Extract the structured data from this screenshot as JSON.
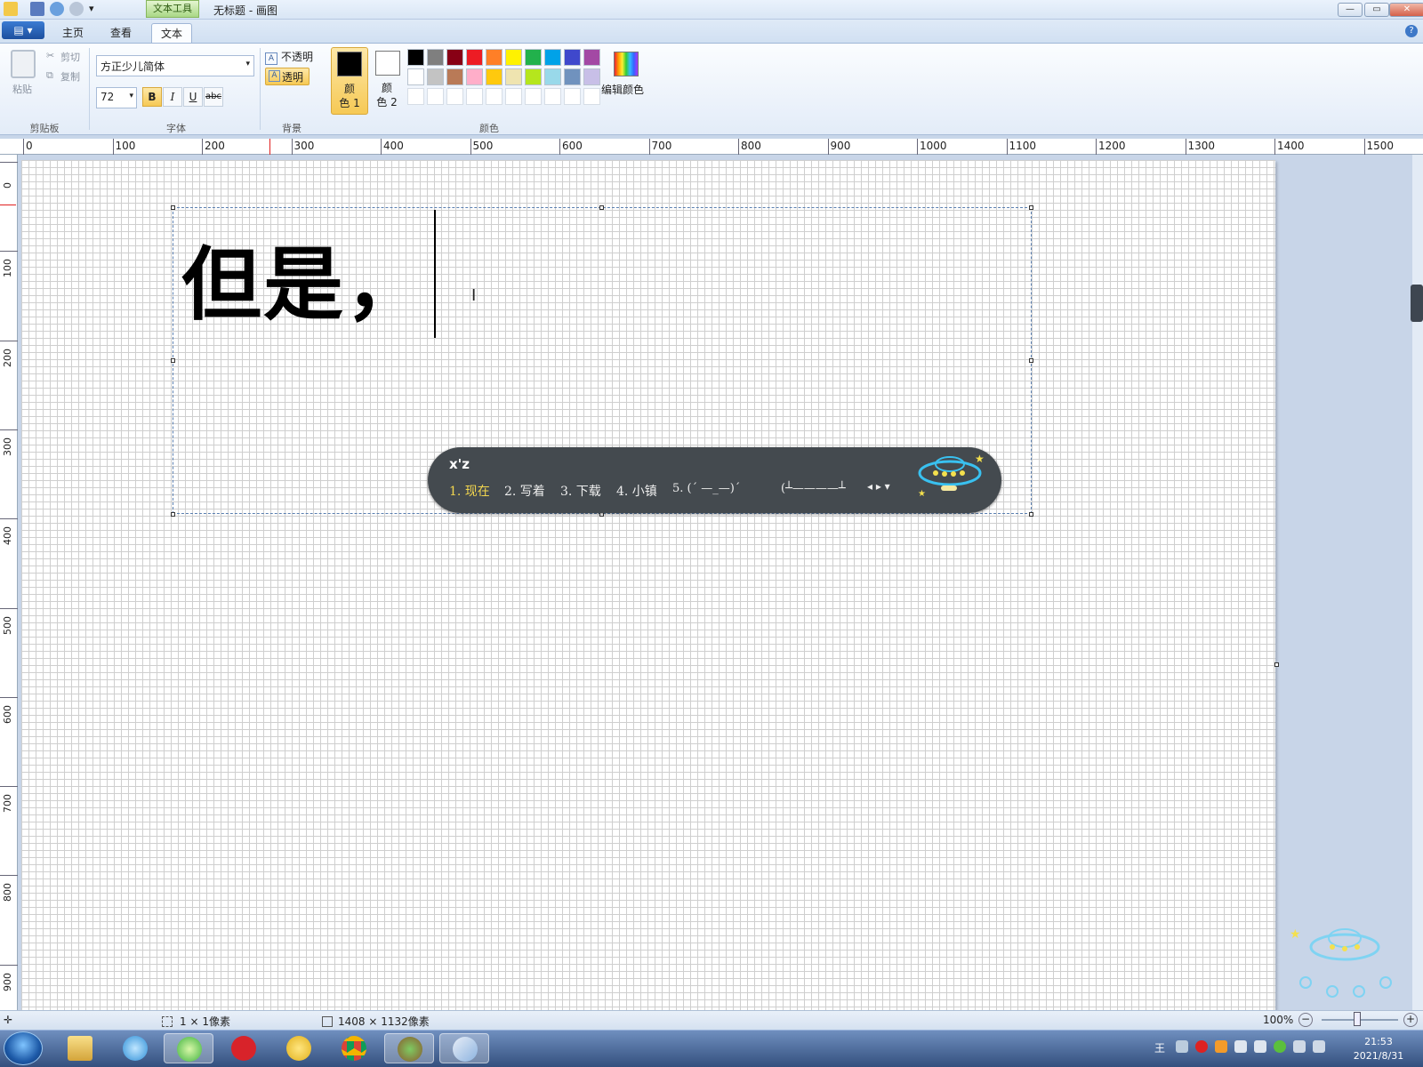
{
  "window": {
    "title": "无标题 - 画图",
    "context_tab": "文本工具",
    "buttons": {
      "minimize": "—",
      "maximize": "▭",
      "close": "✕"
    }
  },
  "tabs": {
    "file": "▤ ▾",
    "items": [
      {
        "label": "主页",
        "active": false
      },
      {
        "label": "查看",
        "active": false
      },
      {
        "label": "文本",
        "active": true
      }
    ],
    "help": "?"
  },
  "ribbon": {
    "clipboard": {
      "paste": "粘贴",
      "cut": "剪切",
      "copy": "复制",
      "group": "剪贴板"
    },
    "font": {
      "family": "方正少儿简体",
      "size": "72",
      "bold": "B",
      "italic": "I",
      "underline": "U",
      "strike": "abc",
      "group": "字体"
    },
    "background": {
      "opaque": "不透明",
      "transparent": "透明",
      "group": "背景"
    },
    "colors": {
      "color1_label": "颜\n色 1",
      "color2_label": "颜\n色 2",
      "color1": "#000000",
      "color2": "#ffffff",
      "edit_colors": "编辑颜色",
      "group": "颜色",
      "palette_row1": [
        "#000000",
        "#7f7f7f",
        "#880015",
        "#ed1c24",
        "#ff7f27",
        "#fff200",
        "#22b14c",
        "#00a2e8",
        "#3f48cc",
        "#a349a4"
      ],
      "palette_row2": [
        "#ffffff",
        "#c3c3c3",
        "#b97a57",
        "#ffaec9",
        "#ffc90e",
        "#efe4b0",
        "#b5e61d",
        "#99d9ea",
        "#7092be",
        "#c8bfe7"
      ],
      "palette_row3": [
        "#ffffff",
        "#ffffff",
        "#ffffff",
        "#ffffff",
        "#ffffff",
        "#ffffff",
        "#ffffff",
        "#ffffff",
        "#ffffff",
        "#ffffff"
      ]
    }
  },
  "rulers": {
    "h": [
      "0",
      "100",
      "200",
      "300",
      "400",
      "500",
      "600",
      "700",
      "800",
      "900",
      "1000",
      "1100",
      "1200",
      "1300",
      "1400",
      "1500"
    ],
    "v": [
      "0",
      "100",
      "200",
      "300",
      "400",
      "500",
      "600",
      "700",
      "800",
      "900"
    ]
  },
  "canvas": {
    "text": "但是，",
    "ibeam": "I"
  },
  "ime": {
    "input": "x'z",
    "candidates": [
      "1. 现在",
      "2. 写着",
      "3. 下载",
      "4. 小镇",
      "5. (ˊ —_—)ˊ",
      "(┴————┴"
    ],
    "arrows": "◂ ▸ ▾"
  },
  "status": {
    "cursor_icon": "✛",
    "selection": "1 × 1像素",
    "canvas_size": "1408 × 1132像素",
    "zoom": "100%",
    "zoom_out": "−",
    "zoom_in": "+"
  },
  "taskbar": {
    "clock_time": "21:53",
    "clock_date": "2021/8/31",
    "ime_indicator": "王"
  }
}
